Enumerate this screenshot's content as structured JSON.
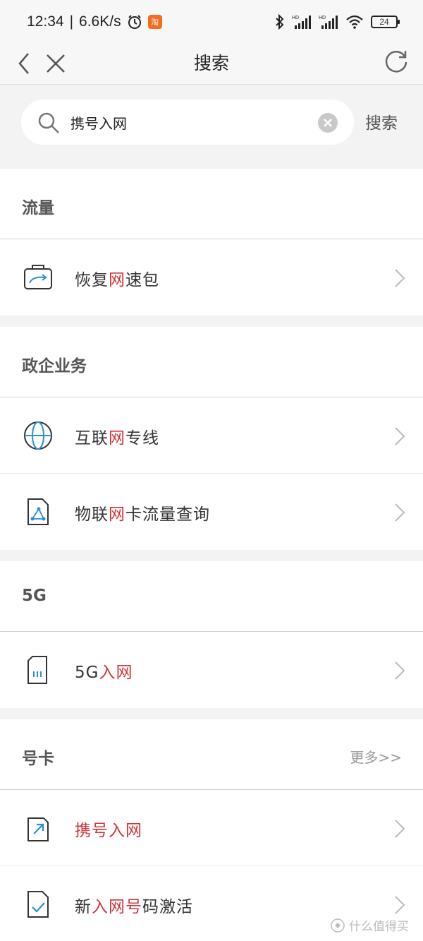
{
  "status_bar": {
    "time": "12:34",
    "network_speed": "6.6K/s",
    "app_badge": "淘",
    "battery": "24"
  },
  "nav": {
    "title": "搜索"
  },
  "search": {
    "query": "携号入网",
    "button_label": "搜索"
  },
  "sections": [
    {
      "title": "流量",
      "items": [
        {
          "label_parts": [
            "恢复",
            "网",
            "速包"
          ],
          "highlight": [
            1
          ],
          "icon": "transfer-bag-icon"
        }
      ]
    },
    {
      "title": "政企业务",
      "items": [
        {
          "label_parts": [
            "互联",
            "网",
            "专线"
          ],
          "highlight": [
            1
          ],
          "icon": "globe-icon"
        },
        {
          "label_parts": [
            "物联",
            "网",
            "卡流量查询"
          ],
          "highlight": [
            1
          ],
          "icon": "iot-card-icon"
        }
      ]
    },
    {
      "title": "5G",
      "items": [
        {
          "label_parts": [
            "5G",
            "入网"
          ],
          "highlight": [
            1
          ],
          "icon": "sim-card-icon"
        }
      ]
    },
    {
      "title": "号卡",
      "more_label": "更多>>",
      "items": [
        {
          "label_parts": [
            "携号入网"
          ],
          "highlight": [
            0
          ],
          "icon": "arrow-box-icon"
        },
        {
          "label_parts": [
            "新",
            "入网号",
            "码激活"
          ],
          "highlight": [
            1
          ],
          "icon": "check-card-icon"
        }
      ]
    }
  ],
  "watermark": "什么值得买",
  "colors": {
    "highlight": "#d0343a",
    "icon_blue": "#2a8fd4",
    "icon_dark": "#333333"
  }
}
